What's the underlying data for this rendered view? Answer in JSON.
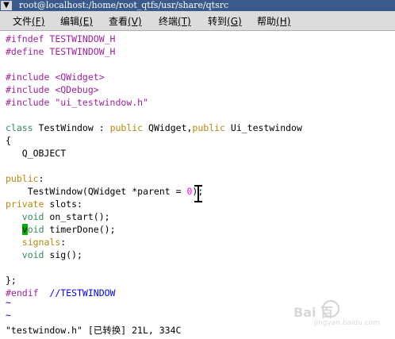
{
  "window": {
    "title": "root@localhost:/home/root_qtfs/usr/share/qtsrc"
  },
  "menu": [
    {
      "label": "文件",
      "key": "(F)"
    },
    {
      "label": "编辑",
      "key": "(E)"
    },
    {
      "label": "查看",
      "key": "(V)"
    },
    {
      "label": "终端",
      "key": "(T)"
    },
    {
      "label": "转到",
      "key": "(G)"
    },
    {
      "label": "帮助",
      "key": "(H)"
    }
  ],
  "code": {
    "l1a": "#ifndef",
    "l1b": " TESTWINDOW_H",
    "l2a": "#define",
    "l2b": " TESTWINDOW_H",
    "l4a": "#include",
    "l4b": " <QWidget>",
    "l5a": "#include",
    "l5b": " <QDebug>",
    "l6a": "#include",
    "l6b": " \"ui_testwindow.h\"",
    "l8a": "class",
    "l8b": " TestWindow : ",
    "l8c": "public",
    "l8d": " QWidget,",
    "l8e": "public",
    "l8f": " Ui_testwindow",
    "l9": "{",
    "l10": "   Q_OBJECT",
    "l12a": "public",
    "l12b": ":",
    "l13a": "    TestWindow(QWidget *parent = ",
    "l13b": "0",
    "l13c": ");",
    "l14a": "private",
    "l14b": " slots:",
    "l15a": "   ",
    "l15b": "void",
    "l15c": " on_start();",
    "l16a": "   ",
    "l16b": "v",
    "l16c": "oid",
    "l16d": " timerDone();",
    "l17a": "   ",
    "l17b": "signals",
    "l17c": ":",
    "l18a": "   ",
    "l18b": "void",
    "l18c": " sig();",
    "l20": "};",
    "l21a": "#endif",
    "l21b": "  //TESTWINDOW",
    "t1": "~",
    "t2": "~"
  },
  "status": {
    "text": "\"testwindow.h\" [已转换] 21L, 334C"
  },
  "watermark": {
    "text": "Bai 百",
    "url": "jingyan.baidu.com"
  },
  "colors": {
    "preprocessor": "#a020a0",
    "keyword": "#b8860b",
    "type": "#2e8b57",
    "comment": "#0000ff",
    "cursor": "#00b000",
    "titlebar": "#3a5a8c"
  }
}
